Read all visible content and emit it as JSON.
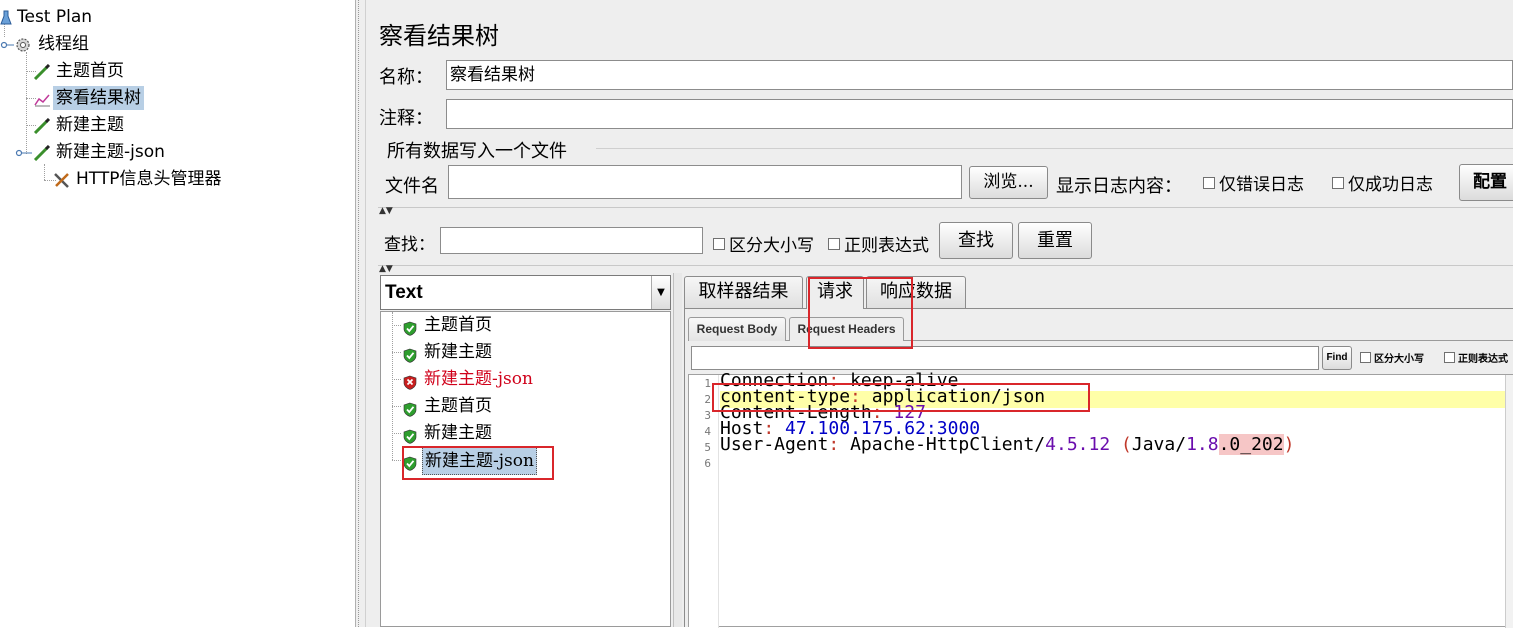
{
  "tree": {
    "items": [
      {
        "label": "Test Plan"
      },
      {
        "label": "线程组"
      },
      {
        "label": "主题首页"
      },
      {
        "label": "察看结果树"
      },
      {
        "label": "新建主题"
      },
      {
        "label": "新建主题-json"
      },
      {
        "label": "HTTP信息头管理器"
      }
    ],
    "selected": "察看结果树"
  },
  "panel": {
    "title": "察看结果树",
    "name_label": "名称：",
    "name_value": "察看结果树",
    "comment_label": "注释：",
    "comment_value": "",
    "file_section_title": "所有数据写入一个文件",
    "filename_label": "文件名",
    "filename_value": "",
    "browse_button": "浏览...",
    "log_content_label": "显示日志内容：",
    "errors_only": "仅错误日志",
    "success_only": "仅成功日志",
    "configure_button": "配置",
    "search_label": "查找：",
    "search_value": "",
    "case_sensitive": "区分大小写",
    "regex": "正则表达式",
    "find_button": "查找",
    "reset_button": "重置"
  },
  "results": {
    "renderer": "Text",
    "items": [
      {
        "label": "主题首页",
        "status": "success"
      },
      {
        "label": "新建主题",
        "status": "success"
      },
      {
        "label": "新建主题-json",
        "status": "error"
      },
      {
        "label": "主题首页",
        "status": "success"
      },
      {
        "label": "新建主题",
        "status": "success"
      },
      {
        "label": "新建主题-json",
        "status": "success",
        "selected": true
      }
    ]
  },
  "tabs": {
    "main": [
      "取样器结果",
      "请求",
      "响应数据"
    ],
    "active_main": "请求",
    "sub": [
      "Request Body",
      "Request Headers"
    ],
    "active_sub": "Request Headers"
  },
  "editor_search": {
    "value": "",
    "find_button": "Find",
    "case_sensitive": "区分大小写",
    "regex": "正则表达式"
  },
  "headers": {
    "line_numbers": [
      "1",
      "2",
      "3",
      "4",
      "5",
      "6"
    ],
    "lines": [
      {
        "key": "Connection",
        "value": "keep-alive"
      },
      {
        "key": "content-type",
        "value": "application/json"
      },
      {
        "key": "Content-Length",
        "value": "127"
      },
      {
        "key": "Host",
        "value": "47.100.175.62:3000"
      },
      {
        "key": "User-Agent",
        "value_parts": [
          "Apache-HttpClient",
          "/",
          "4.5.12",
          " (",
          "Java",
          "/",
          "1.8",
          ".0_202",
          ")"
        ]
      }
    ]
  },
  "colors": {
    "error_text": "#d0021b",
    "highlight_line": "#ffffa8",
    "annotation_red": "#d9262b",
    "selection": "#b8cfe5"
  }
}
